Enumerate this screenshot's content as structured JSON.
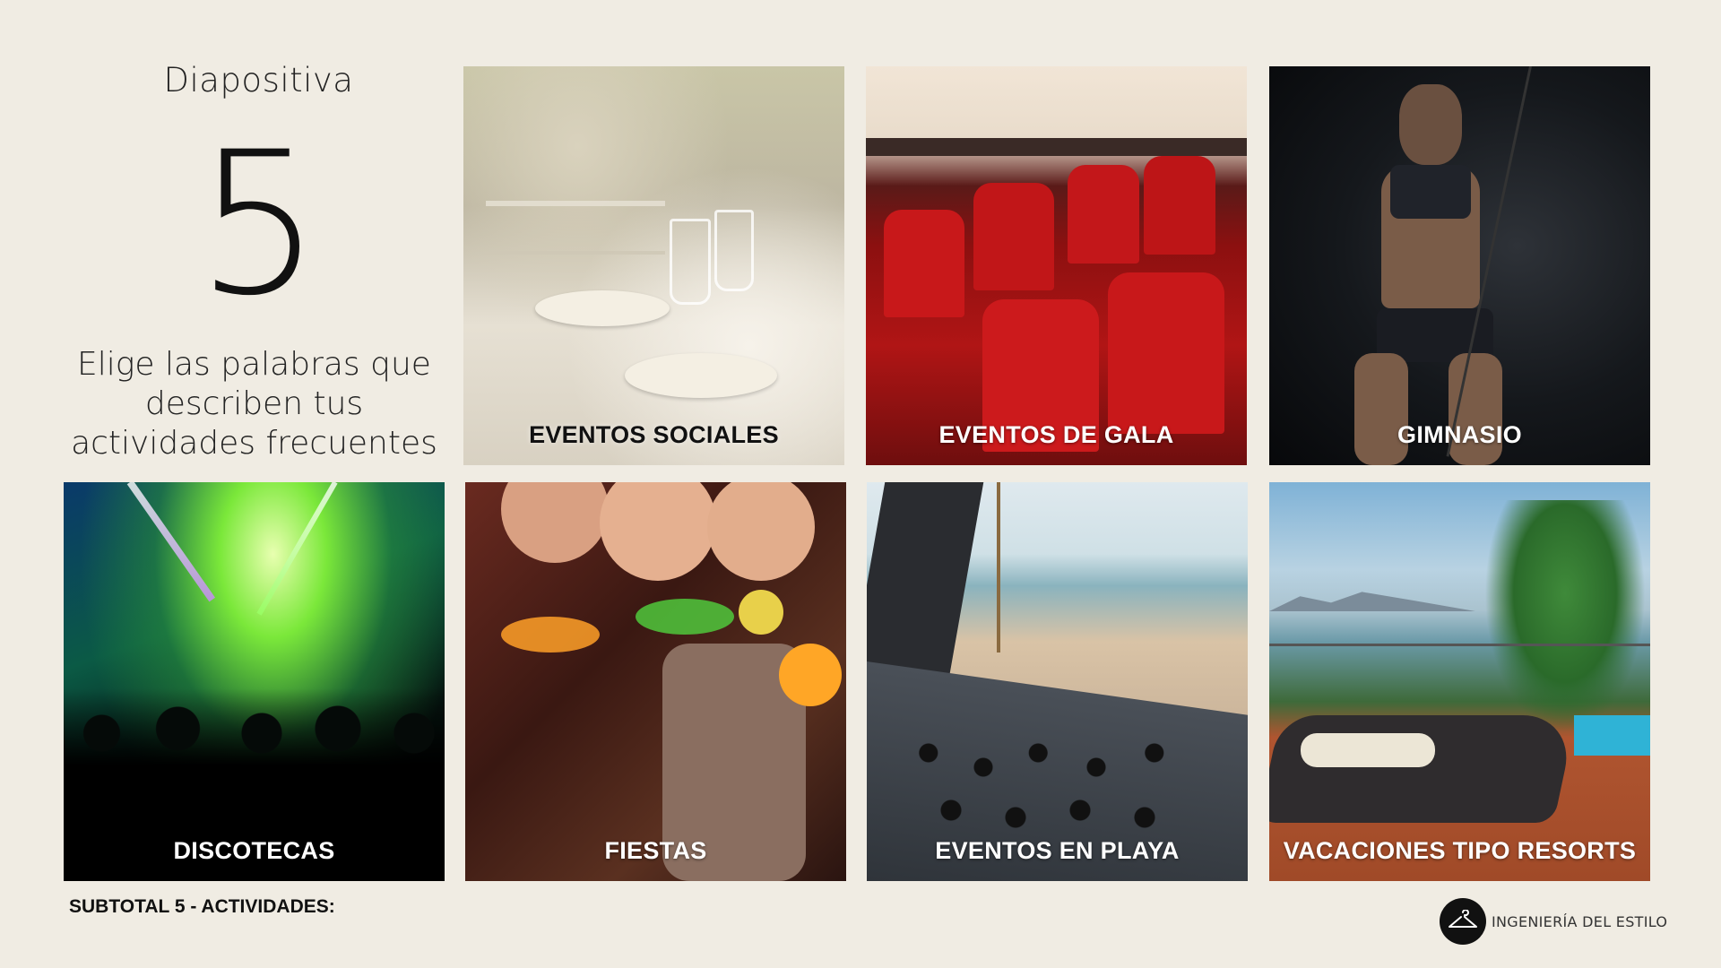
{
  "slide": {
    "label": "Diapositiva",
    "number": "5",
    "subtitle": "Elige las palabras que describen tus actividades frecuentes"
  },
  "tiles": [
    {
      "caption": "EVENTOS SOCIALES"
    },
    {
      "caption": "EVENTOS DE GALA"
    },
    {
      "caption": "GIMNASIO"
    },
    {
      "caption": "DISCOTECAS"
    },
    {
      "caption": "FIESTAS"
    },
    {
      "caption": "EVENTOS EN PLAYA"
    },
    {
      "caption": "VACACIONES TIPO RESORTS"
    }
  ],
  "footer": {
    "subtotal": "SUBTOTAL 5 - ACTIVIDADES:",
    "brand_name": "INGENIERÍA DEL ESTILO",
    "logo_icon": "hanger-icon"
  }
}
